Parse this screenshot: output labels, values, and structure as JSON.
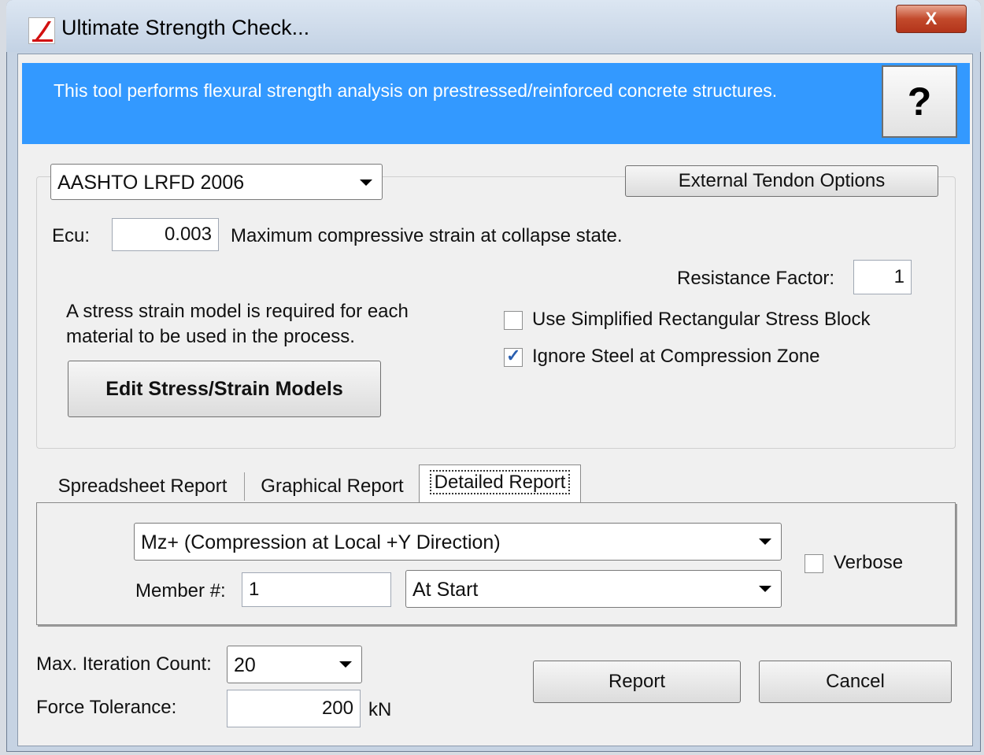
{
  "window": {
    "title": "Ultimate Strength Check...",
    "close_label": "X"
  },
  "banner": {
    "description": "This tool performs flexural strength analysis on prestressed/reinforced concrete structures.",
    "help_label": "?"
  },
  "settings": {
    "code_combo": {
      "selected": "AASHTO LRFD 2006"
    },
    "external_tendon_label": "External Tendon Options",
    "ecu": {
      "label": "Ecu:",
      "value": "0.003",
      "description": "Maximum compressive strain at collapse state."
    },
    "resistance_factor": {
      "label": "Resistance Factor:",
      "value": "1"
    },
    "stress_strain_note": "A stress strain model is required for each material to be used in the process.",
    "edit_models_label": "Edit Stress/Strain Models",
    "use_rect_block": {
      "label": "Use Simplified Rectangular Stress Block",
      "checked": false
    },
    "ignore_steel": {
      "label": "Ignore Steel at Compression Zone",
      "checked": true
    }
  },
  "tabs": [
    {
      "label": "Spreadsheet Report",
      "active": false
    },
    {
      "label": "Graphical Report",
      "active": false
    },
    {
      "label": "Detailed Report",
      "active": true
    }
  ],
  "detailed": {
    "moment_combo": {
      "selected": "Mz+ (Compression at Local +Y Direction)"
    },
    "verbose": {
      "label": "Verbose",
      "checked": false
    },
    "member": {
      "label": "Member #:",
      "value": "1"
    },
    "position_combo": {
      "selected": "At Start"
    }
  },
  "iteration": {
    "label": "Max. Iteration Count:",
    "selected": "20"
  },
  "tolerance": {
    "label": "Force Tolerance:",
    "value": "200",
    "unit": "kN"
  },
  "buttons": {
    "report_label": "Report",
    "cancel_label": "Cancel"
  },
  "colors": {
    "banner": "#3399ff",
    "close": "#c24a2c"
  }
}
